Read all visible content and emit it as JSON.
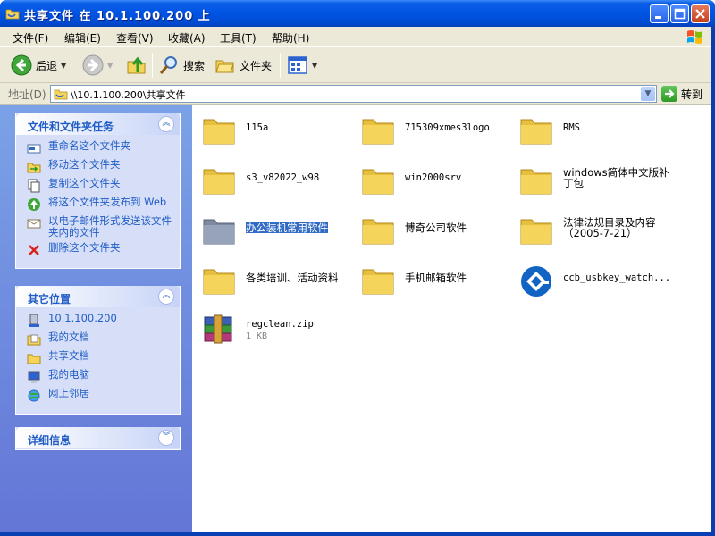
{
  "window": {
    "title": "共享文件 在 10.1.100.200 上"
  },
  "menu": [
    "文件(F)",
    "编辑(E)",
    "查看(V)",
    "收藏(A)",
    "工具(T)",
    "帮助(H)"
  ],
  "toolbar": {
    "back": "后退",
    "search": "搜索",
    "folders": "文件夹"
  },
  "address": {
    "label": "地址(D)",
    "value": "\\\\10.1.100.200\\共享文件",
    "go": "转到"
  },
  "tasks_panel": {
    "title": "文件和文件夹任务",
    "items": [
      {
        "label": "重命名这个文件夹",
        "icon": "rename-icon"
      },
      {
        "label": "移动这个文件夹",
        "icon": "move-icon"
      },
      {
        "label": "复制这个文件夹",
        "icon": "copy-icon"
      },
      {
        "label": "将这个文件夹发布到 Web",
        "icon": "publish-web-icon"
      },
      {
        "label": "以电子邮件形式发送该文件夹内的文件",
        "icon": "email-icon"
      },
      {
        "label": "删除这个文件夹",
        "icon": "delete-icon"
      }
    ]
  },
  "places_panel": {
    "title": "其它位置",
    "items": [
      {
        "label": "10.1.100.200",
        "icon": "network-computer-icon"
      },
      {
        "label": "我的文档",
        "icon": "my-documents-icon"
      },
      {
        "label": "共享文档",
        "icon": "shared-documents-icon"
      },
      {
        "label": "我的电脑",
        "icon": "my-computer-icon"
      },
      {
        "label": "网上邻居",
        "icon": "network-places-icon"
      }
    ]
  },
  "details_panel": {
    "title": "详细信息"
  },
  "files": [
    {
      "name": "115a",
      "type": "folder"
    },
    {
      "name": "715309xmes3logo",
      "type": "folder"
    },
    {
      "name": "RMS",
      "type": "folder"
    },
    {
      "name": "s3_v82022_w98",
      "type": "folder"
    },
    {
      "name": "win2000srv",
      "type": "folder"
    },
    {
      "name": "windows简体中文版补丁包",
      "type": "folder"
    },
    {
      "name": "办公装机常用软件",
      "type": "folder",
      "selected": true
    },
    {
      "name": "博奇公司软件",
      "type": "folder"
    },
    {
      "name": "法律法规目录及内容（2005-7-21）",
      "type": "folder"
    },
    {
      "name": "各类培训、活动资料",
      "type": "folder"
    },
    {
      "name": "手机邮箱软件",
      "type": "folder"
    },
    {
      "name": "ccb_usbkey_watch...",
      "type": "exe"
    },
    {
      "name": "regclean.zip",
      "type": "zip",
      "size": "1 KB"
    }
  ],
  "colors": {
    "titlebar": "#0054e3",
    "task_link": "#215dc6",
    "selection": "#316ac5",
    "sidebar_bg": "#7ba2e7",
    "folder": "#f5d45c"
  }
}
